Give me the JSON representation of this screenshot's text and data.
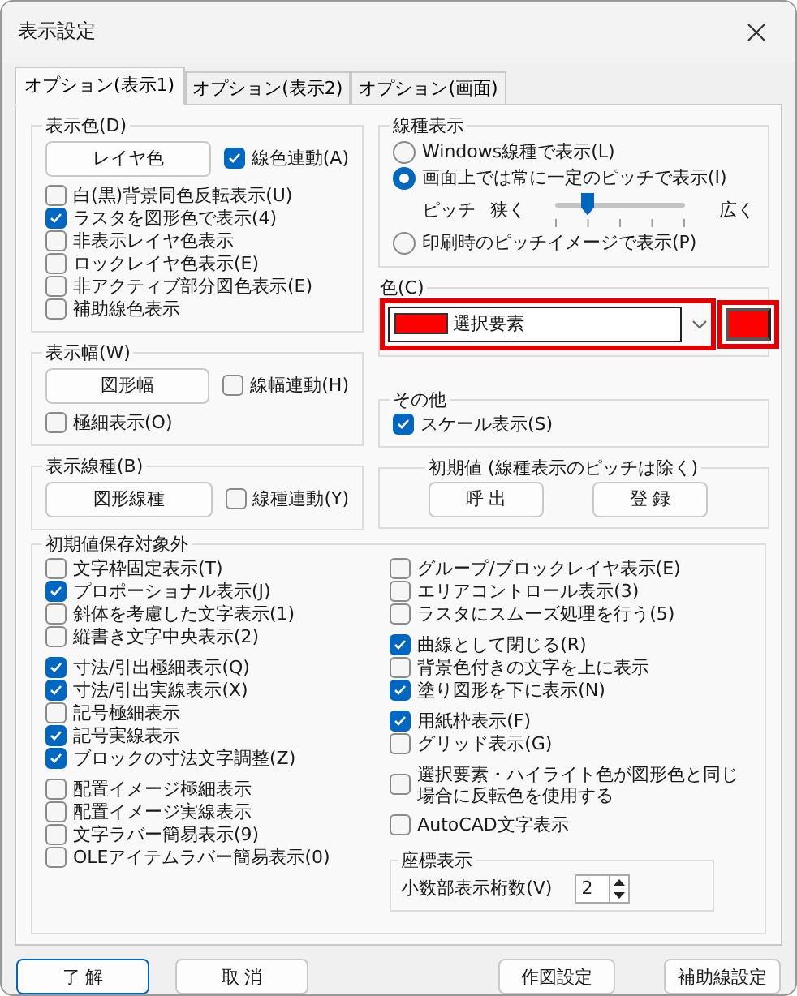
{
  "window": {
    "title": "表示設定"
  },
  "tabs": [
    {
      "label": "オプション(表示1)",
      "selected": true
    },
    {
      "label": "オプション(表示2)",
      "selected": false
    },
    {
      "label": "オプション(画面)",
      "selected": false
    }
  ],
  "display_color": {
    "title": "表示色(D)",
    "button": "レイヤ色",
    "link": {
      "label": "線色連動(A)",
      "checked": true
    },
    "options": [
      {
        "label": "白(黒)背景同色反転表示(U)",
        "checked": false
      },
      {
        "label": "ラスタを図形色で表示(4)",
        "checked": true
      },
      {
        "label": "非表示レイヤ色表示",
        "checked": false
      },
      {
        "label": "ロックレイヤ色表示(E)",
        "checked": false
      },
      {
        "label": "非アクティブ部分図色表示(E)",
        "checked": false
      },
      {
        "label": "補助線色表示",
        "checked": false
      }
    ]
  },
  "display_width": {
    "title": "表示幅(W)",
    "button": "図形幅",
    "link": {
      "label": "線幅連動(H)",
      "checked": false
    },
    "options": [
      {
        "label": "極細表示(O)",
        "checked": false
      }
    ]
  },
  "display_linetype": {
    "title": "表示線種(B)",
    "button": "図形線種",
    "link": {
      "label": "線種連動(Y)",
      "checked": false
    }
  },
  "linetype_display": {
    "title": "線種表示",
    "radios": [
      {
        "label": "Windows線種で表示(L)",
        "selected": false
      },
      {
        "label": "画面上では常に一定のピッチで表示(I)",
        "selected": true
      },
      {
        "label": "印刷時のピッチイメージで表示(P)",
        "selected": false
      }
    ],
    "pitch": {
      "label": "ピッチ",
      "min_label": "狭く",
      "max_label": "広く",
      "level": 0.25
    }
  },
  "color": {
    "title": "色(C)",
    "value": "選択要素",
    "color": "#ff0000"
  },
  "other": {
    "title": "その他",
    "options": [
      {
        "label": "スケール表示(S)",
        "checked": true
      }
    ]
  },
  "defaults": {
    "title": "初期値 (線種表示のピッチは除く)",
    "buttons": [
      "呼 出",
      "登 録"
    ]
  },
  "excluded": {
    "title": "初期値保存対象外",
    "left_sections": [
      {
        "items": [
          {
            "label": "文字枠固定表示(T)",
            "checked": false
          },
          {
            "label": "プロポーショナル表示(J)",
            "checked": true
          },
          {
            "label": "斜体を考慮した文字表示(1)",
            "checked": false
          },
          {
            "label": "縦書き文字中央表示(2)",
            "checked": false
          }
        ]
      },
      {
        "items": [
          {
            "label": "寸法/引出極細表示(Q)",
            "checked": true
          },
          {
            "label": "寸法/引出実線表示(X)",
            "checked": true
          },
          {
            "label": "記号極細表示",
            "checked": false
          },
          {
            "label": "記号実線表示",
            "checked": true
          },
          {
            "label": "ブロックの寸法文字調整(Z)",
            "checked": true
          }
        ]
      },
      {
        "items": [
          {
            "label": "配置イメージ極細表示",
            "checked": false
          },
          {
            "label": "配置イメージ実線表示",
            "checked": false
          },
          {
            "label": "文字ラバー簡易表示(9)",
            "checked": false
          },
          {
            "label": "OLEアイテムラバー簡易表示(0)",
            "checked": false
          }
        ]
      }
    ],
    "right_sections": [
      {
        "items": [
          {
            "label": "グループ/ブロックレイヤ表示(E)",
            "checked": false
          },
          {
            "label": "エリアコントロール表示(3)",
            "checked": false
          },
          {
            "label": "ラスタにスムーズ処理を行う(5)",
            "checked": false
          }
        ]
      },
      {
        "items": [
          {
            "label": "曲線として閉じる(R)",
            "checked": true
          },
          {
            "label": "背景色付きの文字を上に表示",
            "checked": false
          },
          {
            "label": "塗り図形を下に表示(N)",
            "checked": true
          }
        ]
      },
      {
        "items": [
          {
            "label": "用紙枠表示(F)",
            "checked": true
          },
          {
            "label": "グリッド表示(G)",
            "checked": false
          }
        ]
      },
      {
        "items": [
          {
            "label": "選択要素・ハイライト色が図形色と同じ場合に反転色を使用する",
            "checked": false
          }
        ]
      },
      {
        "items": [
          {
            "label": "AutoCAD文字表示",
            "checked": false
          }
        ]
      }
    ],
    "coordinates": {
      "title": "座標表示",
      "label": "小数部表示桁数(V)",
      "value": "2"
    }
  },
  "buttons": {
    "left": [
      "了 解",
      "取 消"
    ],
    "right": [
      "作図設定",
      "補助線設定"
    ]
  }
}
